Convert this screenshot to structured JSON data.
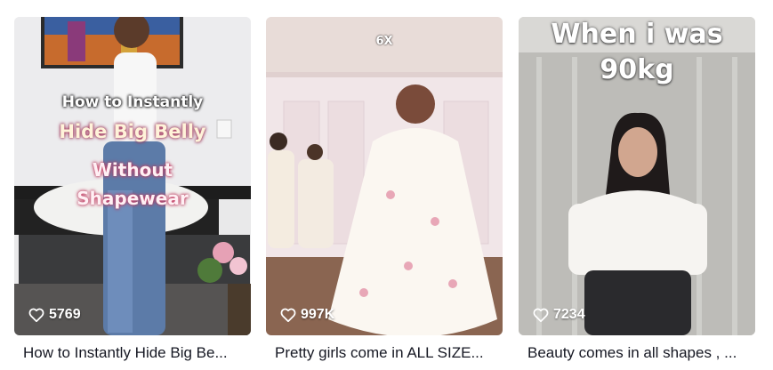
{
  "videos": [
    {
      "overlay": [
        "How to Instantly",
        "Hide Big Belly",
        "Without",
        "Shapewear"
      ],
      "likes": "5769",
      "caption": "How to Instantly Hide Big Be..."
    },
    {
      "overlay": [
        "6X"
      ],
      "likes": "997K",
      "caption": "Pretty girls come in ALL SIZE..."
    },
    {
      "overlay": [
        "When i was",
        "90kg"
      ],
      "likes": "7234",
      "caption": "Beauty comes in all shapes , ..."
    }
  ],
  "icons": {
    "likes": "heart-outline-icon"
  },
  "colors": {
    "caption_text": "#161823",
    "like_text": "#ffffff"
  }
}
